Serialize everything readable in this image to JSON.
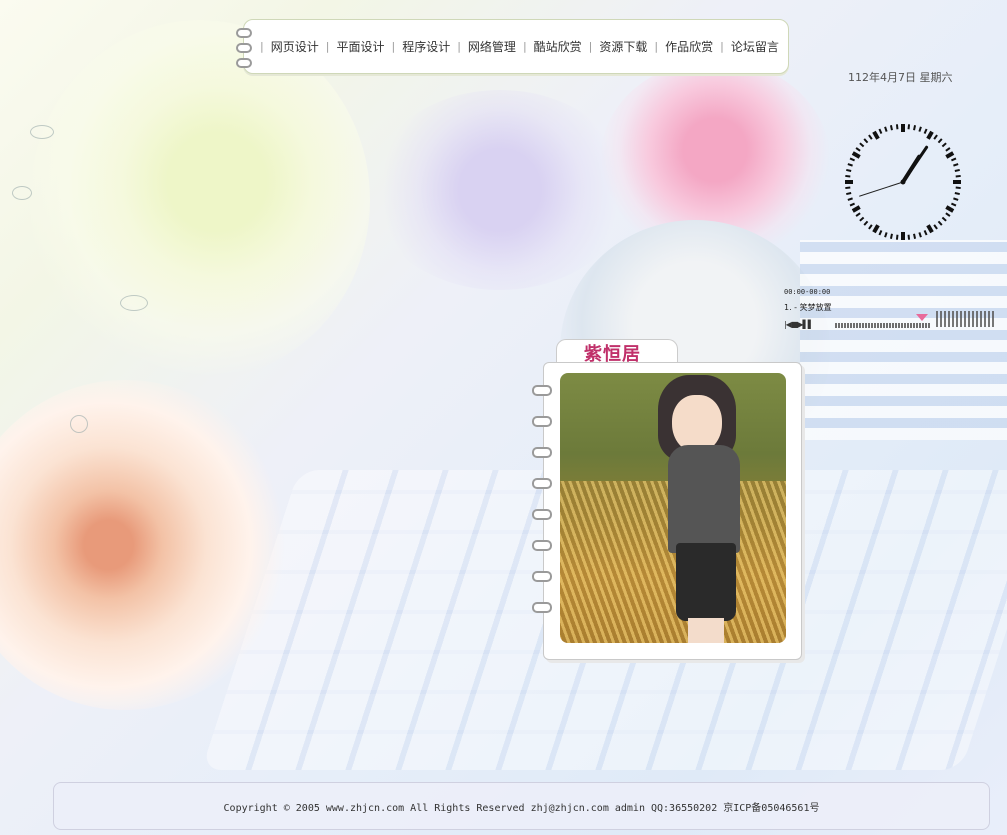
{
  "nav": {
    "items": [
      "网页设计",
      "平面设计",
      "程序设计",
      "网络管理",
      "酷站欣赏",
      "资源下载",
      "作品欣赏",
      "论坛留言"
    ],
    "separator": "|"
  },
  "date": "112年4月7日 星期六",
  "clock": {
    "hour": 1,
    "minute": 5,
    "second": 42
  },
  "player": {
    "time": "00:00-00:00",
    "track": "1. - 笑梦放置",
    "controls": "|◀■▶▌▌"
  },
  "card": {
    "title": "紫恒居"
  },
  "footer": {
    "text": "Copyright © 2005 www.zhjcn.com All Rights Reserved zhj@zhjcn.com admin QQ:36550202 京ICP备05046561号"
  },
  "colors": {
    "accent": "#c0306a",
    "marker": "#e86a9a"
  }
}
